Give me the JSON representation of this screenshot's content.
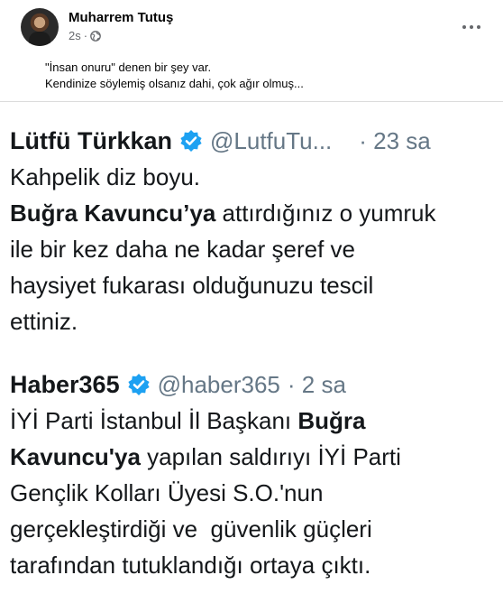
{
  "post": {
    "author": "Muharrem Tutuş",
    "time": "2s",
    "separator": "·",
    "caption_lines": [
      "\"İnsan onuru\" denen bir şey var.",
      "Kendinize söylemiş olsanız dahi, çok ağır olmuş..."
    ]
  },
  "tweets": [
    {
      "name": "Lütfü Türkkan",
      "handle": "@LutfuTu...",
      "time": "· 23 sa",
      "line1": "Kahpelik diz boyu.",
      "line2_bold": "Buğra Kavuncu’ya",
      "line2_rest": " attırdığınız o yumruk",
      "line3": "ile bir kez daha ne kadar şeref ve",
      "line4": "haysiyet fukarası olduğunuzu tescil",
      "line5": "ettiniz."
    },
    {
      "name": "Haber365",
      "handle": "@haber365",
      "time": "· 2 sa",
      "line1_rest": "İYİ Parti İstanbul İl Başkanı ",
      "line1_bold": "Buğra",
      "line2_bold": "Kavuncu'ya",
      "line2_rest": " yapılan saldırıyı İYİ Parti",
      "line3": "Gençlik Kolları Üyesi S.O.'nun",
      "line4": "gerçekleştirdiği ve  güvenlik güçleri",
      "line5": "tarafından tutuklandığı ortaya çıktı."
    }
  ],
  "colors": {
    "verified": "#1da1f2",
    "meta_text": "#65676b",
    "handle_text": "#657786"
  },
  "icons": {
    "globe": "globe-icon",
    "more": "more-options-icon",
    "verified": "verified-badge-icon"
  }
}
